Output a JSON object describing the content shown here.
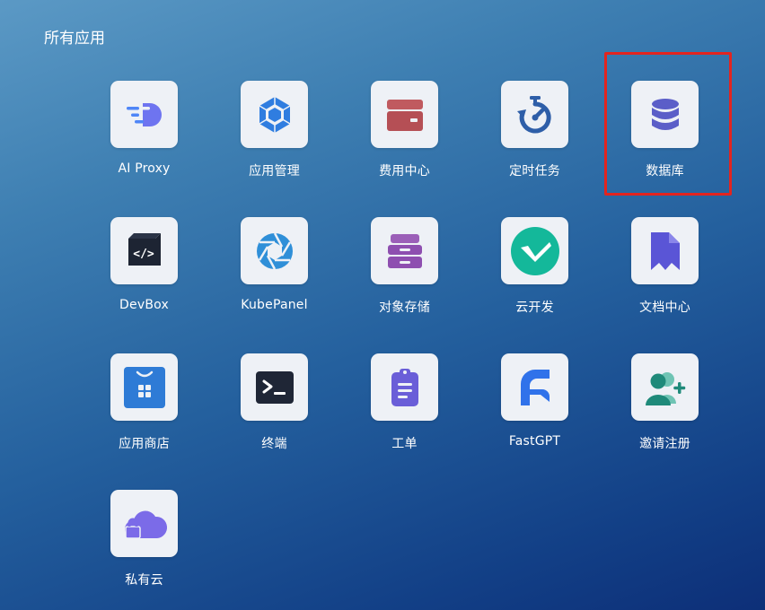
{
  "section": {
    "title": "所有应用"
  },
  "apps": [
    {
      "label": "AI Proxy",
      "icon": "ai-proxy-icon"
    },
    {
      "label": "应用管理",
      "icon": "app-management-icon"
    },
    {
      "label": "费用中心",
      "icon": "wallet-icon"
    },
    {
      "label": "定时任务",
      "icon": "stopwatch-icon"
    },
    {
      "label": "数据库",
      "icon": "database-icon"
    },
    {
      "label": "DevBox",
      "icon": "code-box-icon"
    },
    {
      "label": "KubePanel",
      "icon": "aperture-icon"
    },
    {
      "label": "对象存储",
      "icon": "drawer-storage-icon"
    },
    {
      "label": "云开发",
      "icon": "cloud-dev-logo-icon"
    },
    {
      "label": "文档中心",
      "icon": "document-bookmark-icon"
    },
    {
      "label": "应用商店",
      "icon": "shopping-bag-icon"
    },
    {
      "label": "终端",
      "icon": "terminal-icon"
    },
    {
      "label": "工单",
      "icon": "clipboard-icon"
    },
    {
      "label": "FastGPT",
      "icon": "fastgpt-logo-icon"
    },
    {
      "label": "邀请注册",
      "icon": "add-user-icon"
    },
    {
      "label": "私有云",
      "icon": "cloud-lock-icon"
    }
  ],
  "highlight": {
    "target": "数据库",
    "color": "#e3241f"
  }
}
